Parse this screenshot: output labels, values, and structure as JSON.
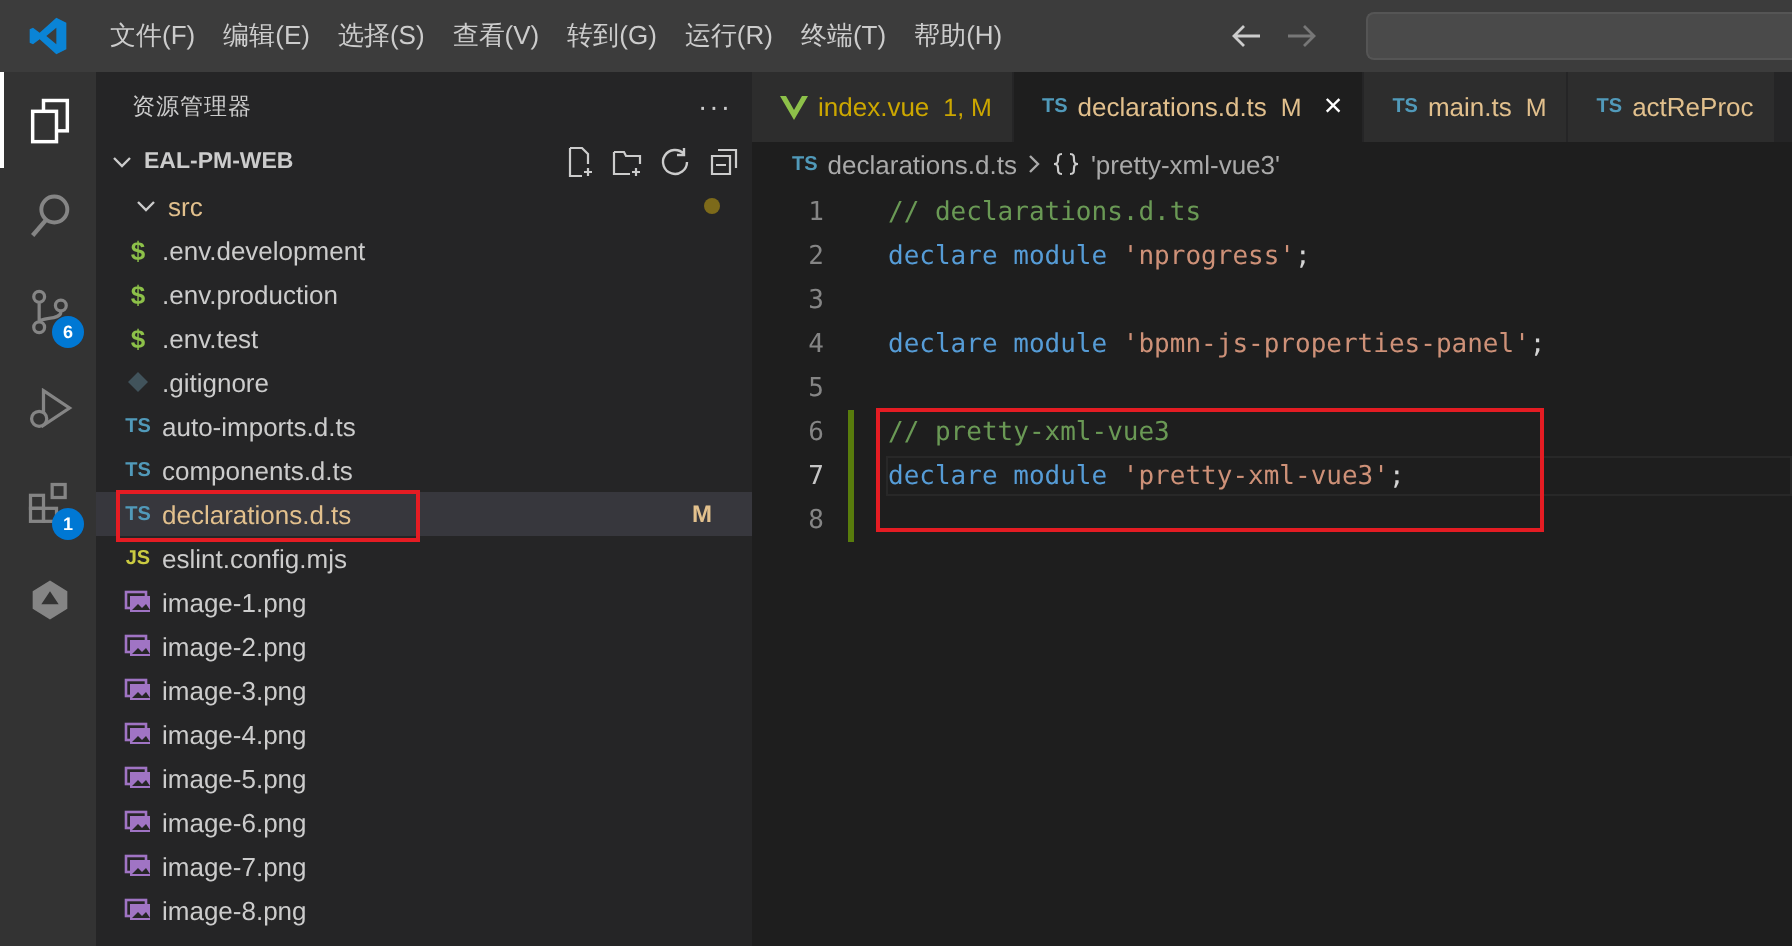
{
  "menu": [
    "文件(F)",
    "编辑(E)",
    "选择(S)",
    "查看(V)",
    "转到(G)",
    "运行(R)",
    "终端(T)",
    "帮助(H)"
  ],
  "activity_bar": [
    {
      "kind": "explorer",
      "selected": true
    },
    {
      "kind": "search",
      "selected": false
    },
    {
      "kind": "source-control",
      "selected": false,
      "badge": "6"
    },
    {
      "kind": "run",
      "selected": false
    },
    {
      "kind": "extensions",
      "selected": false,
      "badge": "1"
    },
    {
      "kind": "remote",
      "selected": false
    }
  ],
  "sidebar": {
    "title": "资源管理器",
    "more": "···",
    "root": {
      "label": "EAL-PM-WEB",
      "expanded": true
    },
    "items": [
      {
        "label": "src",
        "kind": "folder",
        "expanded": true,
        "modified": true,
        "selected": false
      },
      {
        "label": ".env.development",
        "kind": "env",
        "icon": "$",
        "selected": false
      },
      {
        "label": ".env.production",
        "kind": "env",
        "icon": "$",
        "selected": false
      },
      {
        "label": ".env.test",
        "kind": "env",
        "icon": "$",
        "selected": false
      },
      {
        "label": ".gitignore",
        "kind": "git",
        "selected": false
      },
      {
        "label": "auto-imports.d.ts",
        "kind": "ts",
        "icon": "TS",
        "selected": false
      },
      {
        "label": "components.d.ts",
        "kind": "ts",
        "icon": "TS",
        "selected": false
      },
      {
        "label": "declarations.d.ts",
        "kind": "ts",
        "icon": "TS",
        "selected": true,
        "annotated": true,
        "status": "M"
      },
      {
        "label": "eslint.config.mjs",
        "kind": "js",
        "icon": "JS",
        "selected": false
      },
      {
        "label": "image-1.png",
        "kind": "image",
        "selected": false
      },
      {
        "label": "image-2.png",
        "kind": "image",
        "selected": false
      },
      {
        "label": "image-3.png",
        "kind": "image",
        "selected": false
      },
      {
        "label": "image-4.png",
        "kind": "image",
        "selected": false
      },
      {
        "label": "image-5.png",
        "kind": "image",
        "selected": false
      },
      {
        "label": "image-6.png",
        "kind": "image",
        "selected": false
      },
      {
        "label": "image-7.png",
        "kind": "image",
        "selected": false
      },
      {
        "label": "image-8.png",
        "kind": "image",
        "selected": false
      }
    ]
  },
  "tabs": [
    {
      "label": "index.vue",
      "kind": "vue",
      "status": "1, M",
      "selected": false
    },
    {
      "label": "declarations.d.ts",
      "kind": "ts",
      "icon": "TS",
      "status": "M",
      "selected": true,
      "close": "×"
    },
    {
      "label": "main.ts",
      "kind": "ts",
      "icon": "TS",
      "status": "M",
      "selected": false
    },
    {
      "label": "actReProc",
      "kind": "ts",
      "icon": "TS",
      "selected": false
    }
  ],
  "breadcrumb": {
    "icon": "TS",
    "file": "declarations.d.ts",
    "symbol": "'pretty-xml-vue3'"
  },
  "code": [
    {
      "number": "1",
      "added": false,
      "selected": false,
      "tokens": [
        {
          "kind": "comment",
          "text": "// declarations.d.ts"
        }
      ]
    },
    {
      "number": "2",
      "added": false,
      "selected": false,
      "tokens": [
        {
          "kind": "keyword",
          "text": "declare module "
        },
        {
          "kind": "string",
          "text": "'nprogress'"
        },
        {
          "kind": "plain",
          "text": ";"
        }
      ]
    },
    {
      "number": "3",
      "added": false,
      "selected": false
    },
    {
      "number": "4",
      "added": false,
      "selected": false,
      "tokens": [
        {
          "kind": "keyword",
          "text": "declare module "
        },
        {
          "kind": "string",
          "text": "'bpmn-js-properties-panel'"
        },
        {
          "kind": "plain",
          "text": ";"
        }
      ]
    },
    {
      "number": "5",
      "added": false,
      "selected": false
    },
    {
      "number": "6",
      "added": true,
      "selected": false,
      "annotated": true,
      "tokens": [
        {
          "kind": "comment",
          "text": "// pretty-xml-vue3"
        }
      ]
    },
    {
      "number": "7",
      "added": true,
      "selected": true,
      "annotated": true,
      "tokens": [
        {
          "kind": "keyword",
          "text": "declare module "
        },
        {
          "kind": "string",
          "text": "'pretty-xml-vue3'"
        },
        {
          "kind": "plain",
          "text": ";"
        }
      ]
    },
    {
      "number": "8",
      "added": true,
      "selected": false,
      "annotated": true
    }
  ]
}
